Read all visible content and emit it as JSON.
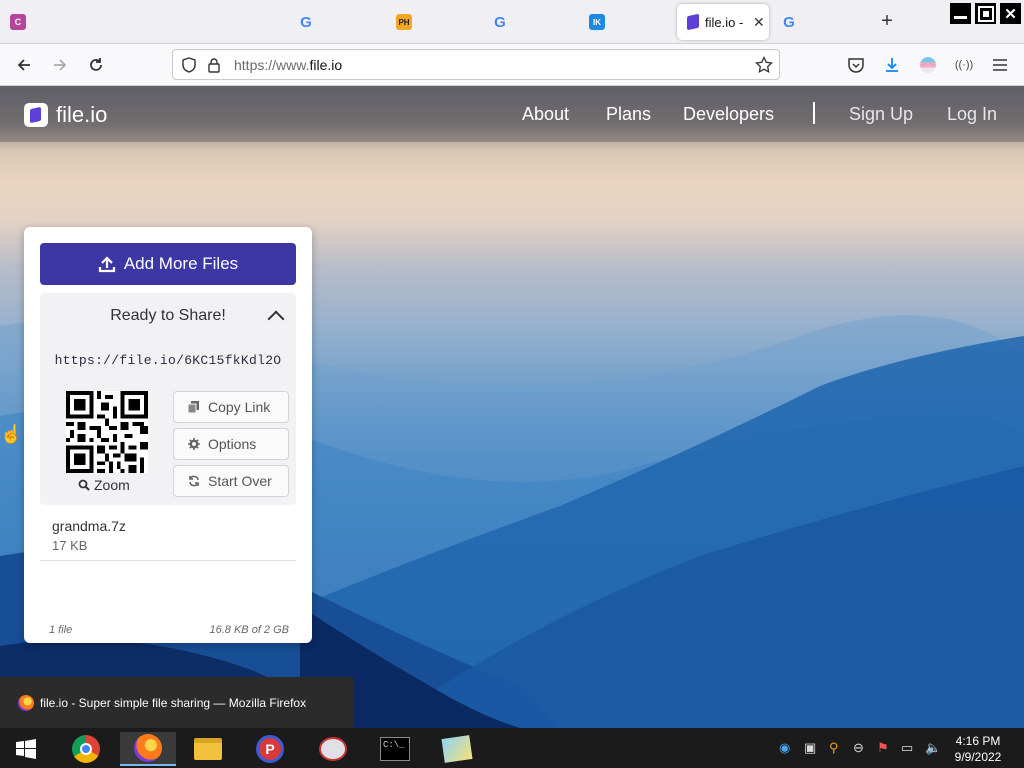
{
  "browser": {
    "tabs": [
      {
        "icon": "C",
        "color": "#b5469b"
      },
      {
        "icon": "G",
        "color": "#4285f4"
      },
      {
        "icon": "PH",
        "color": "#f5a623"
      },
      {
        "icon": "G",
        "color": "#4285f4"
      },
      {
        "icon": "IK",
        "color": "#1e88e5"
      }
    ],
    "active_tab": {
      "title": "file.io -",
      "close": "✕"
    },
    "extra_tab_icon": "G",
    "new_tab": "+",
    "url_prefix": "https://www.",
    "url_domain": "file.io"
  },
  "site": {
    "logo": "file.io",
    "nav": [
      "About",
      "Plans",
      "Developers"
    ],
    "signup": "Sign Up",
    "login": "Log In"
  },
  "card": {
    "add_button": "Add More Files",
    "heading": "Ready to Share!",
    "share_url": "https://file.io/6KC15fkKdl2O",
    "zoom": "Zoom",
    "copy_link": "Copy Link",
    "options": "Options",
    "start_over": "Start Over",
    "file_name": "grandma.7z",
    "file_size": "17 KB",
    "count": "1 file",
    "usage": "16.8 KB of 2 GB"
  },
  "tooltip": "file.io - Super simple file sharing — Mozilla Firefox",
  "clock": {
    "time": "4:16 PM",
    "date": "9/9/2022"
  },
  "colors": {
    "brand": "#3d37a5",
    "accent": "#5b3fd6"
  }
}
